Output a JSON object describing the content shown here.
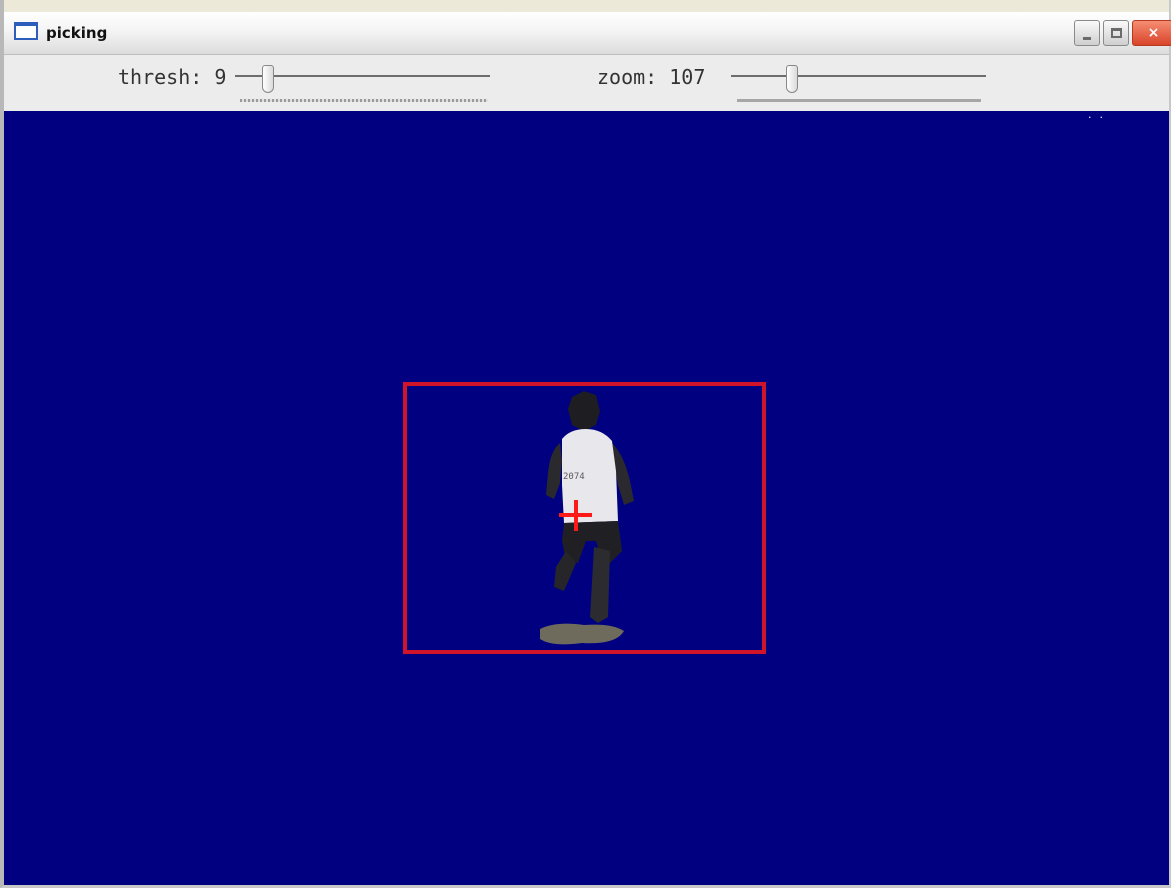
{
  "window": {
    "title": "picking",
    "buttons": {
      "minimize": "minimize",
      "maximize": "maximize",
      "close": "×"
    }
  },
  "toolbar": {
    "thresh": {
      "label": "thresh:",
      "value": "9",
      "fraction": 0.11
    },
    "zoom": {
      "label": "zoom:",
      "value": "107",
      "fraction": 0.24
    }
  },
  "canvas": {
    "background_color": "#000080",
    "selection_color": "#d0142a",
    "marker_color": "#ff1a1a",
    "bib_text": "2074"
  },
  "icons": [
    "window-icon",
    "minimize-icon",
    "maximize-icon",
    "close-icon",
    "crosshair-icon"
  ]
}
